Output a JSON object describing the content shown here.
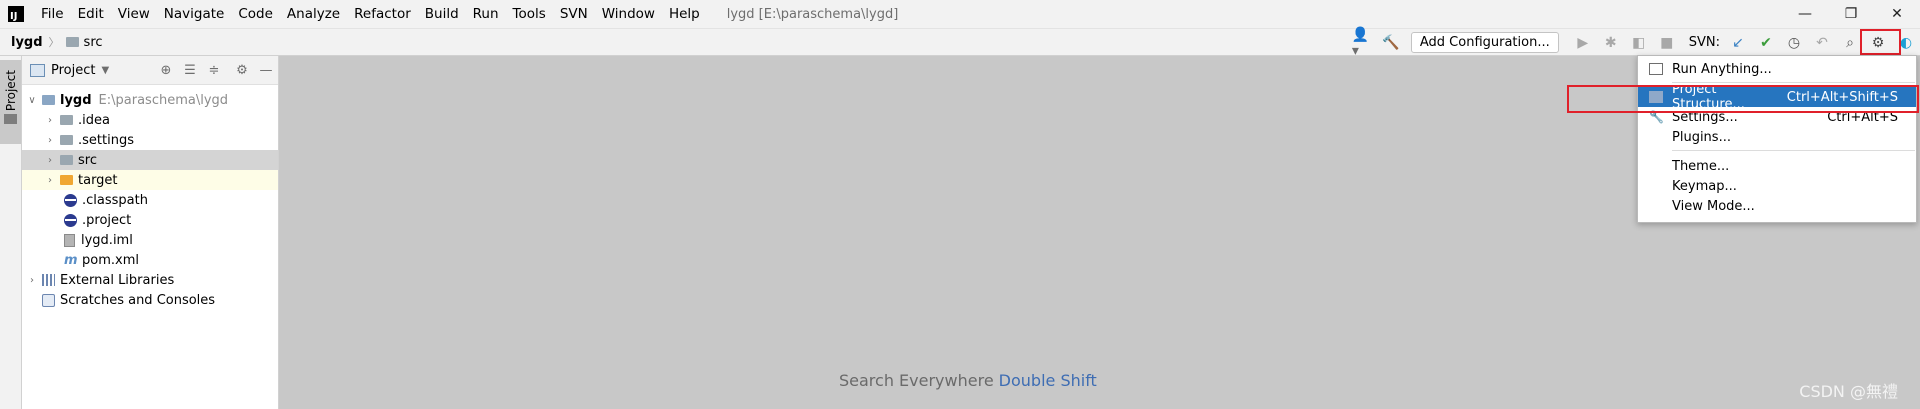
{
  "app": {
    "logo_text": "IJ",
    "window_title": "lygd [E:\\paraschema\\lygd]"
  },
  "menu": [
    "File",
    "Edit",
    "View",
    "Navigate",
    "Code",
    "Analyze",
    "Refactor",
    "Build",
    "Run",
    "Tools",
    "SVN",
    "Window",
    "Help"
  ],
  "window_controls": {
    "minimize": "—",
    "restore": "❐",
    "close": "✕"
  },
  "navbar": {
    "breadcrumb_root": "lygd",
    "breadcrumb_child": "src",
    "add_configuration": "Add Configuration...",
    "svn_label": "SVN:"
  },
  "stripe": {
    "project_tab": "Project"
  },
  "project_panel": {
    "title": "Project",
    "tree": {
      "root_name": "lygd",
      "root_path": "E:\\paraschema\\lygd",
      "idea": ".idea",
      "settings": ".settings",
      "src": "src",
      "target": "target",
      "classpath": ".classpath",
      "project": ".project",
      "iml": "lygd.iml",
      "pom": "pom.xml",
      "external_libraries": "External Libraries",
      "scratches": "Scratches and Consoles"
    }
  },
  "editor": {
    "hint_text": "Search Everywhere",
    "hint_shortcut": "Double Shift"
  },
  "settings_menu": {
    "run_anything": "Run Anything...",
    "project_structure": "Project Structure...",
    "project_structure_shortcut": "Ctrl+Alt+Shift+S",
    "settings": "Settings...",
    "settings_shortcut": "Ctrl+Alt+S",
    "plugins": "Plugins...",
    "theme": "Theme...",
    "keymap": "Keymap...",
    "view_mode": "View Mode..."
  },
  "watermark": "CSDN @無禮",
  "colors": {
    "selection": "#2675bf",
    "highlight_frame": "#e0202a",
    "editor_bg": "#c8c8c8",
    "target_row": "#fefde7"
  }
}
